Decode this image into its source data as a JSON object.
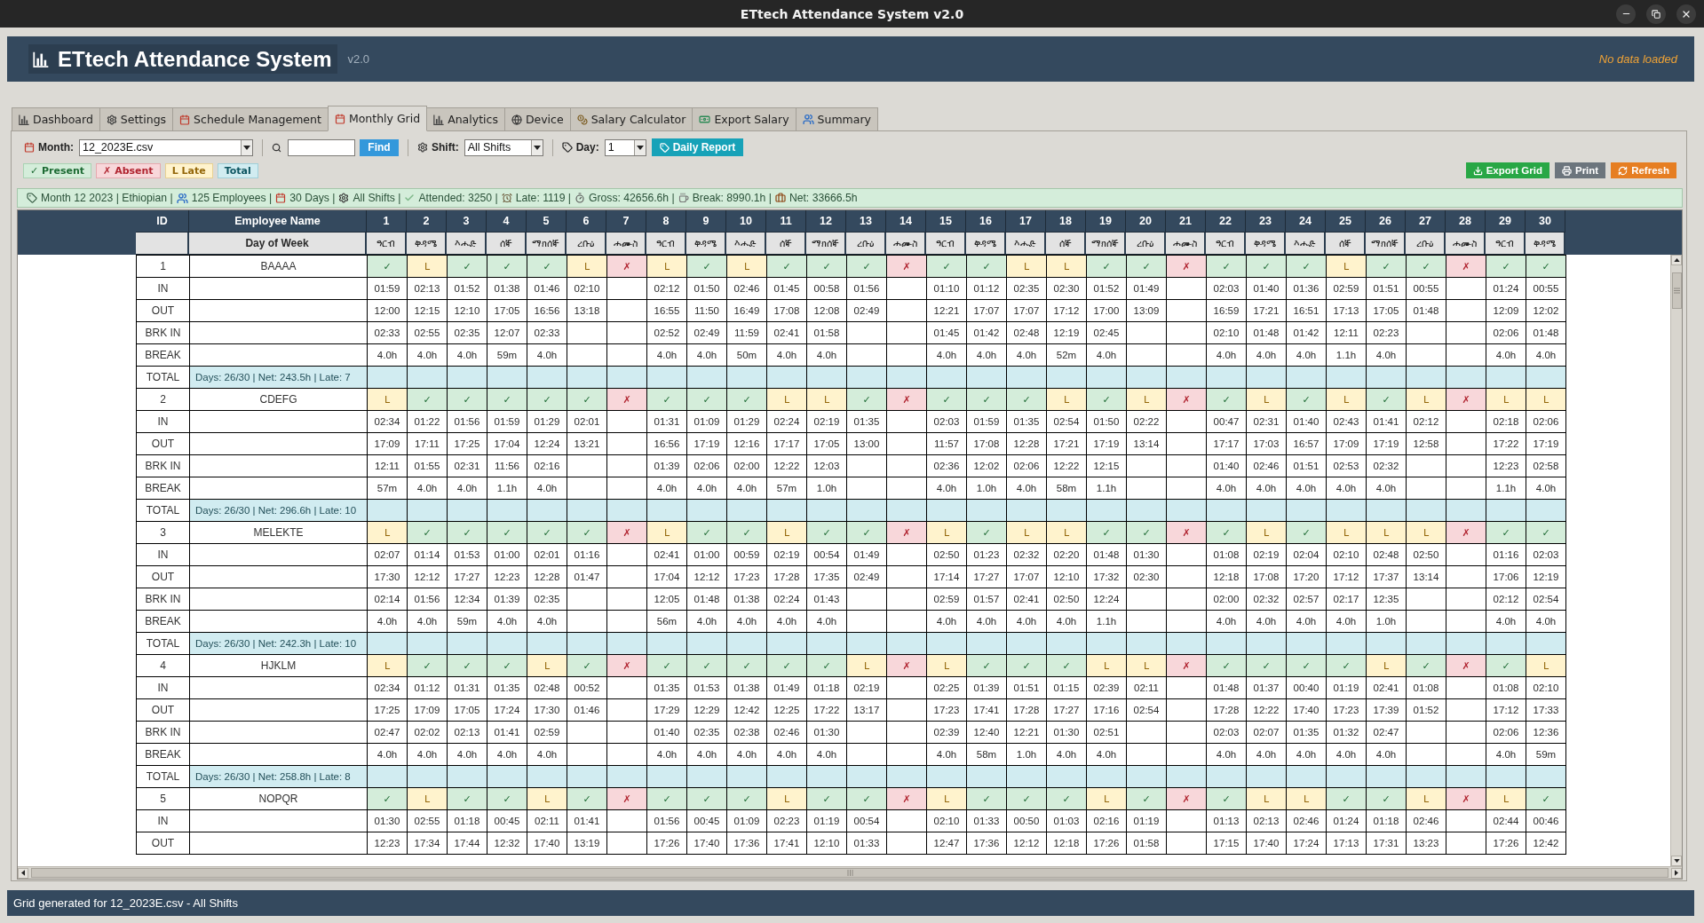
{
  "window": {
    "title": "ETtech Attendance System v2.0"
  },
  "header": {
    "title": "ETtech Attendance System",
    "version": "v2.0",
    "status": "No data loaded"
  },
  "tabs": [
    {
      "label": "Dashboard",
      "selected": false
    },
    {
      "label": "Settings",
      "selected": false
    },
    {
      "label": "Schedule Management",
      "selected": false
    },
    {
      "label": "Monthly Grid",
      "selected": true
    },
    {
      "label": "Analytics",
      "selected": false
    },
    {
      "label": "Device",
      "selected": false
    },
    {
      "label": "Salary Calculator",
      "selected": false
    },
    {
      "label": "Export Salary",
      "selected": false
    },
    {
      "label": "Summary",
      "selected": false
    }
  ],
  "toolbar": {
    "month": {
      "label": "Month:",
      "value": "12_2023E.csv"
    },
    "find_button": "Find",
    "shift": {
      "label": "Shift:",
      "value": "All Shifts"
    },
    "day": {
      "label": "Day:",
      "value": "1"
    },
    "report_button": "Daily Report"
  },
  "legend": [
    {
      "label": "✓ Present",
      "kind": "present"
    },
    {
      "label": "✗ Absent",
      "kind": "absent"
    },
    {
      "label": "L Late",
      "kind": "late"
    },
    {
      "label": "Total",
      "kind": "total"
    }
  ],
  "actions": [
    {
      "label": "Export Grid",
      "kind": "export"
    },
    {
      "label": "Print",
      "kind": "print"
    },
    {
      "label": "Refresh",
      "kind": "refresh"
    }
  ],
  "summary_bar": [
    "Month 12 2023 | Ethiopian |",
    "125 Employees |",
    "30 Days |",
    "All Shifts |",
    "Attended: 3250 |",
    "Late: 1119 |",
    "Gross: 42656.6h |",
    "Break: 8990.1h |",
    "Net: 33666.5h"
  ],
  "grid": {
    "columns": {
      "id": "ID",
      "name": "Employee Name"
    },
    "weekday_label": "Day of Week",
    "days": [
      {
        "number": "1",
        "weekday": "ዓርብ"
      },
      {
        "number": "2",
        "weekday": "ቅዳሜ"
      },
      {
        "number": "3",
        "weekday": "እሑድ"
      },
      {
        "number": "4",
        "weekday": "ሰኞ"
      },
      {
        "number": "5",
        "weekday": "ማክሰኞ"
      },
      {
        "number": "6",
        "weekday": "ረቡዕ"
      },
      {
        "number": "7",
        "weekday": "ሐሙስ"
      },
      {
        "number": "8",
        "weekday": "ዓርብ"
      },
      {
        "number": "9",
        "weekday": "ቅዳሜ"
      },
      {
        "number": "10",
        "weekday": "እሑድ"
      },
      {
        "number": "11",
        "weekday": "ሰኞ"
      },
      {
        "number": "12",
        "weekday": "ማክሰኞ"
      },
      {
        "number": "13",
        "weekday": "ረቡዕ"
      },
      {
        "number": "14",
        "weekday": "ሐሙስ"
      },
      {
        "number": "15",
        "weekday": "ዓርብ"
      },
      {
        "number": "16",
        "weekday": "ቅዳሜ"
      },
      {
        "number": "17",
        "weekday": "እሑድ"
      },
      {
        "number": "18",
        "weekday": "ሰኞ"
      },
      {
        "number": "19",
        "weekday": "ማክሰኞ"
      },
      {
        "number": "20",
        "weekday": "ረቡዕ"
      },
      {
        "number": "21",
        "weekday": "ሐሙስ"
      },
      {
        "number": "22",
        "weekday": "ዓርብ"
      },
      {
        "number": "23",
        "weekday": "ቅዳሜ"
      },
      {
        "number": "24",
        "weekday": "እሑድ"
      },
      {
        "number": "25",
        "weekday": "ሰኞ"
      },
      {
        "number": "26",
        "weekday": "ማክሰኞ"
      },
      {
        "number": "27",
        "weekday": "ረቡዕ"
      },
      {
        "number": "28",
        "weekday": "ሐሙስ"
      },
      {
        "number": "29",
        "weekday": "ዓርብ"
      },
      {
        "number": "30",
        "weekday": "ቅዳሜ"
      }
    ],
    "employees": [
      {
        "id": "1",
        "name": "BAAAA",
        "rows": [
          "IN",
          "OUT",
          "BRK IN",
          "BREAK"
        ],
        "days": [
          {
            "kind": "present",
            "mark": "✓",
            "in": "01:59",
            "out": "12:00",
            "brk_in": "02:33",
            "break": "4.0h"
          },
          {
            "kind": "late",
            "mark": "L",
            "in": "02:13",
            "out": "12:15",
            "brk_in": "02:55",
            "break": "4.0h"
          },
          {
            "kind": "present",
            "mark": "✓",
            "in": "01:52",
            "out": "12:10",
            "brk_in": "02:35",
            "break": "4.0h"
          },
          {
            "kind": "present",
            "mark": "✓",
            "in": "01:38",
            "out": "17:05",
            "brk_in": "12:07",
            "break": "59m"
          },
          {
            "kind": "present",
            "mark": "✓",
            "in": "01:46",
            "out": "16:56",
            "brk_in": "02:33",
            "break": "4.0h"
          },
          {
            "kind": "late",
            "mark": "L",
            "in": "02:10",
            "out": "13:18"
          },
          {
            "kind": "absent",
            "mark": "✗"
          },
          {
            "kind": "late",
            "mark": "L",
            "in": "02:12",
            "out": "16:55",
            "brk_in": "02:52",
            "break": "4.0h"
          },
          {
            "kind": "present",
            "mark": "✓",
            "in": "01:50",
            "out": "11:50",
            "brk_in": "02:49",
            "break": "4.0h"
          },
          {
            "kind": "late",
            "mark": "L",
            "in": "02:46",
            "out": "16:49",
            "brk_in": "11:59",
            "break": "50m"
          },
          {
            "kind": "present",
            "mark": "✓",
            "in": "01:45",
            "out": "17:08",
            "brk_in": "02:41",
            "break": "4.0h"
          },
          {
            "kind": "present",
            "mark": "✓",
            "in": "00:58",
            "out": "12:08",
            "brk_in": "01:58",
            "break": "4.0h"
          },
          {
            "kind": "present",
            "mark": "✓",
            "in": "01:56",
            "out": "02:49"
          },
          {
            "kind": "absent",
            "mark": "✗"
          },
          {
            "kind": "present",
            "mark": "✓",
            "in": "01:10",
            "out": "12:21",
            "brk_in": "01:45",
            "break": "4.0h"
          },
          {
            "kind": "present",
            "mark": "✓",
            "in": "01:12",
            "out": "17:07",
            "brk_in": "01:42",
            "break": "4.0h"
          },
          {
            "kind": "late",
            "mark": "L",
            "in": "02:35",
            "out": "17:07",
            "brk_in": "02:48",
            "break": "4.0h"
          },
          {
            "kind": "late",
            "mark": "L",
            "in": "02:30",
            "out": "17:12",
            "brk_in": "12:19",
            "break": "52m"
          },
          {
            "kind": "present",
            "mark": "✓",
            "in": "01:52",
            "out": "17:00",
            "brk_in": "02:45",
            "break": "4.0h"
          },
          {
            "kind": "present",
            "mark": "✓",
            "in": "01:49",
            "out": "13:09"
          },
          {
            "kind": "absent",
            "mark": "✗"
          },
          {
            "kind": "present",
            "mark": "✓",
            "in": "02:03",
            "out": "16:59",
            "brk_in": "02:10",
            "break": "4.0h"
          },
          {
            "kind": "present",
            "mark": "✓",
            "in": "01:40",
            "out": "17:21",
            "brk_in": "01:48",
            "break": "4.0h"
          },
          {
            "kind": "present",
            "mark": "✓",
            "in": "01:36",
            "out": "16:51",
            "brk_in": "01:42",
            "break": "4.0h"
          },
          {
            "kind": "late",
            "mark": "L",
            "in": "02:59",
            "out": "17:13",
            "brk_in": "12:11",
            "break": "1.1h"
          },
          {
            "kind": "present",
            "mark": "✓",
            "in": "01:51",
            "out": "17:05",
            "brk_in": "02:23",
            "break": "4.0h"
          },
          {
            "kind": "present",
            "mark": "✓",
            "in": "00:55",
            "out": "01:48"
          },
          {
            "kind": "absent",
            "mark": "✗"
          },
          {
            "kind": "present",
            "mark": "✓",
            "in": "01:24",
            "out": "12:09",
            "brk_in": "02:06",
            "break": "4.0h"
          },
          {
            "kind": "present",
            "mark": "✓",
            "in": "00:55",
            "out": "12:02",
            "brk_in": "01:48",
            "break": "4.0h"
          }
        ],
        "total": {
          "label": "TOTAL",
          "summary": "Days: 26/30 | Net: 243.5h | Late: 7"
        }
      },
      {
        "id": "2",
        "name": "CDEFG",
        "rows": [
          "IN",
          "OUT",
          "BRK IN",
          "BREAK"
        ],
        "days": [
          {
            "kind": "late",
            "mark": "L",
            "in": "02:34",
            "out": "17:09",
            "brk_in": "12:11",
            "break": "57m"
          },
          {
            "kind": "present",
            "mark": "✓",
            "in": "01:22",
            "out": "17:11",
            "brk_in": "01:55",
            "break": "4.0h"
          },
          {
            "kind": "present",
            "mark": "✓",
            "in": "01:56",
            "out": "17:25",
            "brk_in": "02:31",
            "break": "4.0h"
          },
          {
            "kind": "present",
            "mark": "✓",
            "in": "01:59",
            "out": "17:04",
            "brk_in": "11:56",
            "break": "1.1h"
          },
          {
            "kind": "present",
            "mark": "✓",
            "in": "01:29",
            "out": "12:24",
            "brk_in": "02:16",
            "break": "4.0h"
          },
          {
            "kind": "present",
            "mark": "✓",
            "in": "02:01",
            "out": "13:21"
          },
          {
            "kind": "absent",
            "mark": "✗"
          },
          {
            "kind": "present",
            "mark": "✓",
            "in": "01:31",
            "out": "16:56",
            "brk_in": "01:39",
            "break": "4.0h"
          },
          {
            "kind": "present",
            "mark": "✓",
            "in": "01:09",
            "out": "17:19",
            "brk_in": "02:06",
            "break": "4.0h"
          },
          {
            "kind": "present",
            "mark": "✓",
            "in": "01:29",
            "out": "12:16",
            "brk_in": "02:00",
            "break": "4.0h"
          },
          {
            "kind": "late",
            "mark": "L",
            "in": "02:24",
            "out": "17:17",
            "brk_in": "12:22",
            "break": "57m"
          },
          {
            "kind": "late",
            "mark": "L",
            "in": "02:19",
            "out": "17:05",
            "brk_in": "12:03",
            "break": "1.0h"
          },
          {
            "kind": "present",
            "mark": "✓",
            "in": "01:35",
            "out": "13:00"
          },
          {
            "kind": "absent",
            "mark": "✗"
          },
          {
            "kind": "present",
            "mark": "✓",
            "in": "02:03",
            "out": "11:57",
            "brk_in": "02:36",
            "break": "4.0h"
          },
          {
            "kind": "present",
            "mark": "✓",
            "in": "01:59",
            "out": "17:08",
            "brk_in": "12:02",
            "break": "1.0h"
          },
          {
            "kind": "present",
            "mark": "✓",
            "in": "01:35",
            "out": "12:28",
            "brk_in": "02:06",
            "break": "4.0h"
          },
          {
            "kind": "late",
            "mark": "L",
            "in": "02:54",
            "out": "17:21",
            "brk_in": "12:22",
            "break": "58m"
          },
          {
            "kind": "present",
            "mark": "✓",
            "in": "01:50",
            "out": "17:19",
            "brk_in": "12:15",
            "break": "1.1h"
          },
          {
            "kind": "late",
            "mark": "L",
            "in": "02:22",
            "out": "13:14"
          },
          {
            "kind": "absent",
            "mark": "✗"
          },
          {
            "kind": "present",
            "mark": "✓",
            "in": "00:47",
            "out": "17:17",
            "brk_in": "01:40",
            "break": "4.0h"
          },
          {
            "kind": "late",
            "mark": "L",
            "in": "02:31",
            "out": "17:03",
            "brk_in": "02:46",
            "break": "4.0h"
          },
          {
            "kind": "present",
            "mark": "✓",
            "in": "01:40",
            "out": "16:57",
            "brk_in": "01:51",
            "break": "4.0h"
          },
          {
            "kind": "late",
            "mark": "L",
            "in": "02:43",
            "out": "17:09",
            "brk_in": "02:53",
            "break": "4.0h"
          },
          {
            "kind": "present",
            "mark": "✓",
            "in": "01:41",
            "out": "17:19",
            "brk_in": "02:32",
            "break": "4.0h"
          },
          {
            "kind": "late",
            "mark": "L",
            "in": "02:12",
            "out": "12:58"
          },
          {
            "kind": "absent",
            "mark": "✗"
          },
          {
            "kind": "late",
            "mark": "L",
            "in": "02:18",
            "out": "17:22",
            "brk_in": "12:23",
            "break": "1.1h"
          },
          {
            "kind": "late",
            "mark": "L",
            "in": "02:06",
            "out": "17:19",
            "brk_in": "02:58",
            "break": "4.0h"
          }
        ],
        "total": {
          "label": "TOTAL",
          "summary": "Days: 26/30 | Net: 296.6h | Late: 10"
        }
      },
      {
        "id": "3",
        "name": "MELEKTE",
        "rows": [
          "IN",
          "OUT",
          "BRK IN",
          "BREAK"
        ],
        "days": [
          {
            "kind": "late",
            "mark": "L",
            "in": "02:07",
            "out": "17:30",
            "brk_in": "02:14",
            "break": "4.0h"
          },
          {
            "kind": "present",
            "mark": "✓",
            "in": "01:14",
            "out": "12:12",
            "brk_in": "01:56",
            "break": "4.0h"
          },
          {
            "kind": "present",
            "mark": "✓",
            "in": "01:53",
            "out": "17:27",
            "brk_in": "12:34",
            "break": "59m"
          },
          {
            "kind": "present",
            "mark": "✓",
            "in": "01:00",
            "out": "12:23",
            "brk_in": "01:39",
            "break": "4.0h"
          },
          {
            "kind": "present",
            "mark": "✓",
            "in": "02:01",
            "out": "12:28",
            "brk_in": "02:35",
            "break": "4.0h"
          },
          {
            "kind": "present",
            "mark": "✓",
            "in": "01:16",
            "out": "01:47"
          },
          {
            "kind": "absent",
            "mark": "✗"
          },
          {
            "kind": "late",
            "mark": "L",
            "in": "02:41",
            "out": "17:04",
            "brk_in": "12:05",
            "break": "56m"
          },
          {
            "kind": "present",
            "mark": "✓",
            "in": "01:00",
            "out": "12:12",
            "brk_in": "01:48",
            "break": "4.0h"
          },
          {
            "kind": "present",
            "mark": "✓",
            "in": "00:59",
            "out": "17:23",
            "brk_in": "01:38",
            "break": "4.0h"
          },
          {
            "kind": "late",
            "mark": "L",
            "in": "02:19",
            "out": "17:28",
            "brk_in": "02:24",
            "break": "4.0h"
          },
          {
            "kind": "present",
            "mark": "✓",
            "in": "00:54",
            "out": "17:35",
            "brk_in": "01:43",
            "break": "4.0h"
          },
          {
            "kind": "present",
            "mark": "✓",
            "in": "01:49",
            "out": "02:49"
          },
          {
            "kind": "absent",
            "mark": "✗"
          },
          {
            "kind": "late",
            "mark": "L",
            "in": "02:50",
            "out": "17:14",
            "brk_in": "02:59",
            "break": "4.0h"
          },
          {
            "kind": "present",
            "mark": "✓",
            "in": "01:23",
            "out": "17:27",
            "brk_in": "01:57",
            "break": "4.0h"
          },
          {
            "kind": "late",
            "mark": "L",
            "in": "02:32",
            "out": "17:07",
            "brk_in": "02:41",
            "break": "4.0h"
          },
          {
            "kind": "late",
            "mark": "L",
            "in": "02:20",
            "out": "12:10",
            "brk_in": "02:50",
            "break": "4.0h"
          },
          {
            "kind": "present",
            "mark": "✓",
            "in": "01:48",
            "out": "17:32",
            "brk_in": "12:24",
            "break": "1.1h"
          },
          {
            "kind": "present",
            "mark": "✓",
            "in": "01:30",
            "out": "02:30"
          },
          {
            "kind": "absent",
            "mark": "✗"
          },
          {
            "kind": "present",
            "mark": "✓",
            "in": "01:08",
            "out": "12:18",
            "brk_in": "02:00",
            "break": "4.0h"
          },
          {
            "kind": "late",
            "mark": "L",
            "in": "02:19",
            "out": "17:08",
            "brk_in": "02:32",
            "break": "4.0h"
          },
          {
            "kind": "present",
            "mark": "✓",
            "in": "02:04",
            "out": "17:20",
            "brk_in": "02:57",
            "break": "4.0h"
          },
          {
            "kind": "late",
            "mark": "L",
            "in": "02:10",
            "out": "17:12",
            "brk_in": "02:17",
            "break": "4.0h"
          },
          {
            "kind": "late",
            "mark": "L",
            "in": "02:48",
            "out": "17:37",
            "brk_in": "12:35",
            "break": "1.0h"
          },
          {
            "kind": "late",
            "mark": "L",
            "in": "02:50",
            "out": "13:14"
          },
          {
            "kind": "absent",
            "mark": "✗"
          },
          {
            "kind": "present",
            "mark": "✓",
            "in": "01:16",
            "out": "17:06",
            "brk_in": "02:12",
            "break": "4.0h"
          },
          {
            "kind": "present",
            "mark": "✓",
            "in": "02:03",
            "out": "12:19",
            "brk_in": "02:54",
            "break": "4.0h"
          }
        ],
        "total": {
          "label": "TOTAL",
          "summary": "Days: 26/30 | Net: 242.3h | Late: 10"
        }
      },
      {
        "id": "4",
        "name": "HJKLM",
        "rows": [
          "IN",
          "OUT",
          "BRK IN",
          "BREAK"
        ],
        "days": [
          {
            "kind": "late",
            "mark": "L",
            "in": "02:34",
            "out": "17:25",
            "brk_in": "02:47",
            "break": "4.0h"
          },
          {
            "kind": "present",
            "mark": "✓",
            "in": "01:12",
            "out": "17:09",
            "brk_in": "02:02",
            "break": "4.0h"
          },
          {
            "kind": "present",
            "mark": "✓",
            "in": "01:31",
            "out": "17:05",
            "brk_in": "02:13",
            "break": "4.0h"
          },
          {
            "kind": "present",
            "mark": "✓",
            "in": "01:35",
            "out": "17:24",
            "brk_in": "01:41",
            "break": "4.0h"
          },
          {
            "kind": "late",
            "mark": "L",
            "in": "02:48",
            "out": "17:30",
            "brk_in": "02:59",
            "break": "4.0h"
          },
          {
            "kind": "present",
            "mark": "✓",
            "in": "00:52",
            "out": "01:46"
          },
          {
            "kind": "absent",
            "mark": "✗"
          },
          {
            "kind": "present",
            "mark": "✓",
            "in": "01:35",
            "out": "17:29",
            "brk_in": "01:40",
            "break": "4.0h"
          },
          {
            "kind": "present",
            "mark": "✓",
            "in": "01:53",
            "out": "12:29",
            "brk_in": "02:35",
            "break": "4.0h"
          },
          {
            "kind": "present",
            "mark": "✓",
            "in": "01:38",
            "out": "12:42",
            "brk_in": "02:38",
            "break": "4.0h"
          },
          {
            "kind": "present",
            "mark": "✓",
            "in": "01:49",
            "out": "12:25",
            "brk_in": "02:46",
            "break": "4.0h"
          },
          {
            "kind": "present",
            "mark": "✓",
            "in": "01:18",
            "out": "17:22",
            "brk_in": "01:30",
            "break": "4.0h"
          },
          {
            "kind": "late",
            "mark": "L",
            "in": "02:19",
            "out": "13:17"
          },
          {
            "kind": "absent",
            "mark": "✗"
          },
          {
            "kind": "late",
            "mark": "L",
            "in": "02:25",
            "out": "17:23",
            "brk_in": "02:39",
            "break": "4.0h"
          },
          {
            "kind": "present",
            "mark": "✓",
            "in": "01:39",
            "out": "17:41",
            "brk_in": "12:40",
            "break": "58m"
          },
          {
            "kind": "present",
            "mark": "✓",
            "in": "01:51",
            "out": "17:28",
            "brk_in": "12:21",
            "break": "1.0h"
          },
          {
            "kind": "present",
            "mark": "✓",
            "in": "01:15",
            "out": "17:27",
            "brk_in": "01:30",
            "break": "4.0h"
          },
          {
            "kind": "late",
            "mark": "L",
            "in": "02:39",
            "out": "17:16",
            "brk_in": "02:51",
            "break": "4.0h"
          },
          {
            "kind": "late",
            "mark": "L",
            "in": "02:11",
            "out": "02:54"
          },
          {
            "kind": "absent",
            "mark": "✗"
          },
          {
            "kind": "present",
            "mark": "✓",
            "in": "01:48",
            "out": "17:28",
            "brk_in": "02:03",
            "break": "4.0h"
          },
          {
            "kind": "present",
            "mark": "✓",
            "in": "01:37",
            "out": "12:22",
            "brk_in": "02:07",
            "break": "4.0h"
          },
          {
            "kind": "present",
            "mark": "✓",
            "in": "00:40",
            "out": "17:40",
            "brk_in": "01:35",
            "break": "4.0h"
          },
          {
            "kind": "present",
            "mark": "✓",
            "in": "01:19",
            "out": "17:23",
            "brk_in": "01:32",
            "break": "4.0h"
          },
          {
            "kind": "late",
            "mark": "L",
            "in": "02:41",
            "out": "17:39",
            "brk_in": "02:47",
            "break": "4.0h"
          },
          {
            "kind": "present",
            "mark": "✓",
            "in": "01:08",
            "out": "01:52"
          },
          {
            "kind": "absent",
            "mark": "✗"
          },
          {
            "kind": "present",
            "mark": "✓",
            "in": "01:08",
            "out": "17:12",
            "brk_in": "02:06",
            "break": "4.0h"
          },
          {
            "kind": "late",
            "mark": "L",
            "in": "02:10",
            "out": "17:33",
            "brk_in": "12:36",
            "break": "59m"
          }
        ],
        "total": {
          "label": "TOTAL",
          "summary": "Days: 26/30 | Net: 258.8h | Late: 8"
        }
      },
      {
        "id": "5",
        "name": "NOPQR",
        "rows": [
          "IN",
          "OUT"
        ],
        "days": [
          {
            "kind": "present",
            "mark": "✓",
            "in": "01:30",
            "out": "12:23"
          },
          {
            "kind": "late",
            "mark": "L",
            "in": "02:55",
            "out": "17:34"
          },
          {
            "kind": "present",
            "mark": "✓",
            "in": "01:18",
            "out": "17:44"
          },
          {
            "kind": "present",
            "mark": "✓",
            "in": "00:45",
            "out": "12:32"
          },
          {
            "kind": "late",
            "mark": "L",
            "in": "02:11",
            "out": "17:40"
          },
          {
            "kind": "present",
            "mark": "✓",
            "in": "01:41",
            "out": "13:19"
          },
          {
            "kind": "absent",
            "mark": "✗"
          },
          {
            "kind": "present",
            "mark": "✓",
            "in": "01:56",
            "out": "17:26"
          },
          {
            "kind": "present",
            "mark": "✓",
            "in": "00:45",
            "out": "17:40"
          },
          {
            "kind": "present",
            "mark": "✓",
            "in": "01:09",
            "out": "17:36"
          },
          {
            "kind": "late",
            "mark": "L",
            "in": "02:23",
            "out": "17:41"
          },
          {
            "kind": "present",
            "mark": "✓",
            "in": "01:19",
            "out": "12:10"
          },
          {
            "kind": "present",
            "mark": "✓",
            "in": "00:54",
            "out": "01:33"
          },
          {
            "kind": "absent",
            "mark": "✗"
          },
          {
            "kind": "late",
            "mark": "L",
            "in": "02:10",
            "out": "12:47"
          },
          {
            "kind": "present",
            "mark": "✓",
            "in": "01:33",
            "out": "17:36"
          },
          {
            "kind": "present",
            "mark": "✓",
            "in": "00:50",
            "out": "12:12"
          },
          {
            "kind": "present",
            "mark": "✓",
            "in": "01:03",
            "out": "12:18"
          },
          {
            "kind": "late",
            "mark": "L",
            "in": "02:16",
            "out": "17:26"
          },
          {
            "kind": "present",
            "mark": "✓",
            "in": "01:19",
            "out": "01:58"
          },
          {
            "kind": "absent",
            "mark": "✗"
          },
          {
            "kind": "present",
            "mark": "✓",
            "in": "01:13",
            "out": "17:15"
          },
          {
            "kind": "late",
            "mark": "L",
            "in": "02:13",
            "out": "17:40"
          },
          {
            "kind": "late",
            "mark": "L",
            "in": "02:46",
            "out": "17:24"
          },
          {
            "kind": "present",
            "mark": "✓",
            "in": "01:24",
            "out": "17:13"
          },
          {
            "kind": "present",
            "mark": "✓",
            "in": "01:18",
            "out": "17:31"
          },
          {
            "kind": "late",
            "mark": "L",
            "in": "02:46",
            "out": "13:23"
          },
          {
            "kind": "absent",
            "mark": "✗"
          },
          {
            "kind": "late",
            "mark": "L",
            "in": "02:44",
            "out": "17:26"
          },
          {
            "kind": "present",
            "mark": "✓",
            "in": "00:46",
            "out": "12:42"
          }
        ]
      }
    ]
  },
  "status_bar": "Grid generated for 12_2023E.csv - All Shifts"
}
